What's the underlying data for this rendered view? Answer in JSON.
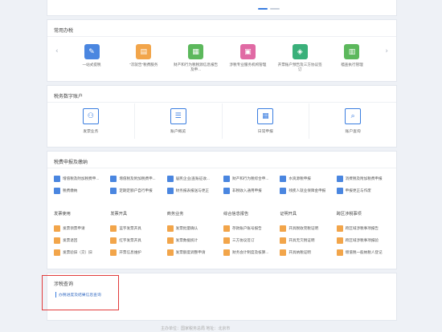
{
  "frequent": {
    "title": "常用办税",
    "items": [
      {
        "label": "一站式提税",
        "color": "#4a86e0",
        "icon": "pen-icon"
      },
      {
        "label": "\"次就告\"税费服务",
        "color": "#f2a54a",
        "icon": "form-icon"
      },
      {
        "label": "财产和行为税税源信息报告及申...",
        "color": "#5cb85c",
        "icon": "document-icon"
      },
      {
        "label": "涉税专业服务机构管理",
        "color": "#e06aa4",
        "icon": "bag-icon"
      },
      {
        "label": "开票账户预告及三方协议签订",
        "color": "#3ab07a",
        "icon": "shield-icon"
      },
      {
        "label": "稽查执行管理",
        "color": "#5cb85c",
        "icon": "report-icon"
      }
    ]
  },
  "account": {
    "title": "税务数字账户",
    "items": [
      {
        "label": "发票业务",
        "icon": "invoice-icon"
      },
      {
        "label": "账户概览",
        "icon": "overview-icon"
      },
      {
        "label": "日常申报",
        "icon": "calendar-icon"
      },
      {
        "label": "账户查询",
        "icon": "search-doc-icon"
      }
    ]
  },
  "declare": {
    "title": "税费申报及缴纳",
    "rows": [
      [
        "增值税及附加税费申...",
        "增值税及附加税费申...",
        "居民企业(查账征收...",
        "财产和行为税综合申...",
        "水资源税申报",
        "消费税及附加税费申报"
      ],
      [
        "税费缴纳",
        "定期定额户自行申报",
        "财务报表报送与更正",
        "非税收入通用申报",
        "残疾人就业保障金申报",
        "申报更正与作废"
      ]
    ],
    "headers": [
      "发票使用",
      "发票开具",
      "商务业务",
      "综合信息报告",
      "证明开具",
      "跨区涉税事项"
    ],
    "rows2": [
      [
        "发票领票申请",
        "蓝字发票开具",
        "发票批量确认",
        "存款账户账号报告",
        "开具税收完税证明",
        "跨区域涉税事项报告"
      ],
      [
        "发票退回",
        "红字发票开具",
        "发票数据统计",
        "三方协议签订",
        "开具无欠税证明",
        "跨区域涉税事项报验"
      ],
      [
        "发票验旧（交）旧",
        "开票信息维护",
        "发票额度调整申请",
        "财务会计制度及核算...",
        "开具纳税证明",
        "增值税一般纳税人登记"
      ]
    ]
  },
  "query": {
    "title": "涉税查询",
    "link": "办税进度及结果信息查询"
  },
  "footer": "主办单位：国家税务总局 地址：北京市"
}
